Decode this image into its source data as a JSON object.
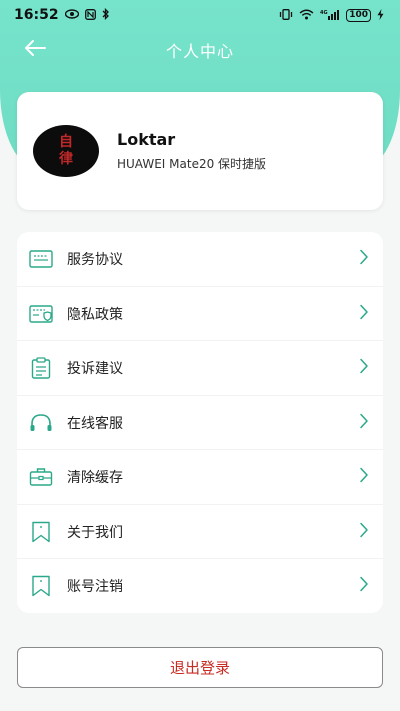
{
  "status_bar": {
    "time": "16:52",
    "battery": "100",
    "left_icons": [
      "eye-icon",
      "nfc-icon",
      "bluetooth-icon"
    ],
    "right_icons": [
      "vibrate-icon",
      "wifi-icon",
      "signal-4g-icon",
      "battery-icon",
      "charging-icon"
    ]
  },
  "nav": {
    "title": "个人中心"
  },
  "profile": {
    "name": "Loktar",
    "device": "HUAWEI Mate20 保时捷版",
    "avatar_char_1": "自",
    "avatar_char_2": "律"
  },
  "menu": {
    "items": [
      {
        "label": "服务协议",
        "icon": "agreement-icon"
      },
      {
        "label": "隐私政策",
        "icon": "privacy-icon"
      },
      {
        "label": "投诉建议",
        "icon": "clipboard-icon"
      },
      {
        "label": "在线客服",
        "icon": "headset-icon"
      },
      {
        "label": "清除缓存",
        "icon": "briefcase-icon"
      },
      {
        "label": "关于我们",
        "icon": "bookmark-icon"
      },
      {
        "label": "账号注销",
        "icon": "bookmark-icon"
      }
    ]
  },
  "logout": {
    "label": "退出登录"
  },
  "colors": {
    "accent": "#6fdcc4",
    "icon_green": "#2aa889",
    "logout_text": "#c72b21"
  }
}
